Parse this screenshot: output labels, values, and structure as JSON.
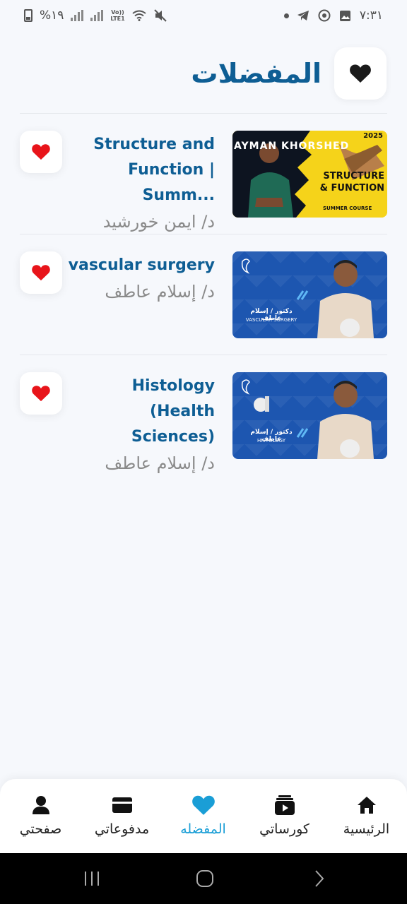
{
  "status_bar": {
    "time": "٧:٣١",
    "battery": "%١٩",
    "network": "LTE1",
    "volte": "Vo))"
  },
  "header": {
    "title": "المفضلات",
    "icon": "heart-icon"
  },
  "courses": [
    {
      "title": "Structure and Function | Summ...",
      "title_line1": "Structure and",
      "title_line2": "Function | Summ...",
      "author": "د/ ايمن خورشيد",
      "thumb": {
        "style": "yellow",
        "name": "AYMAN KHORSHED",
        "subject": "STRUCTURE & FUNCTION",
        "year": "2025",
        "note": "SUMMER COURSE"
      }
    },
    {
      "title": "vascular surgery",
      "title_line1": "vascular surgery",
      "title_line2": "",
      "author": "د/ إسلام عاطف",
      "thumb": {
        "style": "blue",
        "name": "دكتور / إسلام عاطف",
        "subject": "VASCULAR SURGERY"
      }
    },
    {
      "title": "Histology (Health Sciences)",
      "title_line1": "Histology (Health",
      "title_line2": "Sciences)",
      "author": "د/ إسلام عاطف",
      "thumb": {
        "style": "blue",
        "name": "دكتور / إسلام عاطف",
        "subject": "HISTOLOGY"
      }
    }
  ],
  "bottom_nav": {
    "items": [
      {
        "label": "الرئيسية",
        "icon": "home-icon"
      },
      {
        "label": "كورساتي",
        "icon": "courses-icon"
      },
      {
        "label": "المفضله",
        "icon": "heart-icon",
        "active": true
      },
      {
        "label": "مدفوعاتي",
        "icon": "card-icon"
      },
      {
        "label": "صفحتي",
        "icon": "user-icon"
      }
    ]
  },
  "colors": {
    "primary": "#0e5e94",
    "active": "#1a9ed6",
    "heart": "#e8141a",
    "background": "#f6f8fc"
  }
}
